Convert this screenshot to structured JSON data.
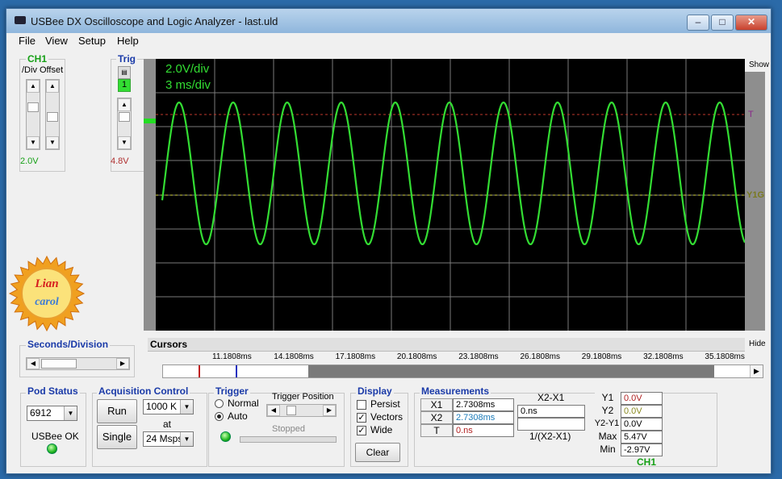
{
  "window": {
    "title": "USBee DX Oscilloscope and Logic Analyzer - last.uld"
  },
  "menu": [
    "File",
    "View",
    "Setup",
    "Help"
  ],
  "ch1": {
    "label": "CH1",
    "sublabel": "/Div Offset",
    "value": "2.0V"
  },
  "trig": {
    "label": "Trig",
    "channel": "1",
    "value": "4.8V"
  },
  "scope": {
    "volts_div": "2.0V/div",
    "time_div": "3 ms/div",
    "show_label": "Show",
    "trigger_marker": "T",
    "ground_marker": "Y1G",
    "colors": {
      "trace": "#33dd33",
      "background": "#000000",
      "grid": "#7a7a7a",
      "trigger_line": "#c0392b",
      "ground_line": "#d8d840"
    }
  },
  "cursors": {
    "label": "Cursors",
    "hide_label": "Hide",
    "ticks": [
      "11.1808ms",
      "14.1808ms",
      "17.1808ms",
      "20.1808ms",
      "23.1808ms",
      "26.1808ms",
      "29.1808ms",
      "32.1808ms",
      "35.1808ms"
    ]
  },
  "seconds_division": {
    "label": "Seconds/Division"
  },
  "pod_status": {
    "label": "Pod Status",
    "pod": "6912",
    "status": "USBee OK"
  },
  "acquisition": {
    "label": "Acquisition Control",
    "run": "Run",
    "single": "Single",
    "samples": "1000 K",
    "at": "at",
    "rate": "24 Msps"
  },
  "trigger": {
    "label": "Trigger",
    "normal": "Normal",
    "auto": "Auto",
    "position_label": "Trigger Position",
    "state": "Stopped"
  },
  "display": {
    "label": "Display",
    "persist": "Persist",
    "vectors": "Vectors",
    "wide": "Wide",
    "clear": "Clear"
  },
  "measurements": {
    "label": "Measurements",
    "x1_label": "X1",
    "x1": "2.7308ms",
    "x2_label": "X2",
    "x2": "2.7308ms",
    "t_label": "T",
    "t": "0.ns",
    "x2x1_label": "X2-X1",
    "x2x1": "0.ns",
    "inv_label": "1/(X2-X1)",
    "y1_label": "Y1",
    "y1": "0.0V",
    "y2_label": "Y2",
    "y2": "0.0V",
    "y2y1_label": "Y2-Y1",
    "y2y1": "0.0V",
    "max_label": "Max",
    "max": "5.47V",
    "min_label": "Min",
    "min": "-2.97V",
    "channel": "CH1"
  },
  "logo": {
    "top": "Lian",
    "bottom": "carol"
  }
}
